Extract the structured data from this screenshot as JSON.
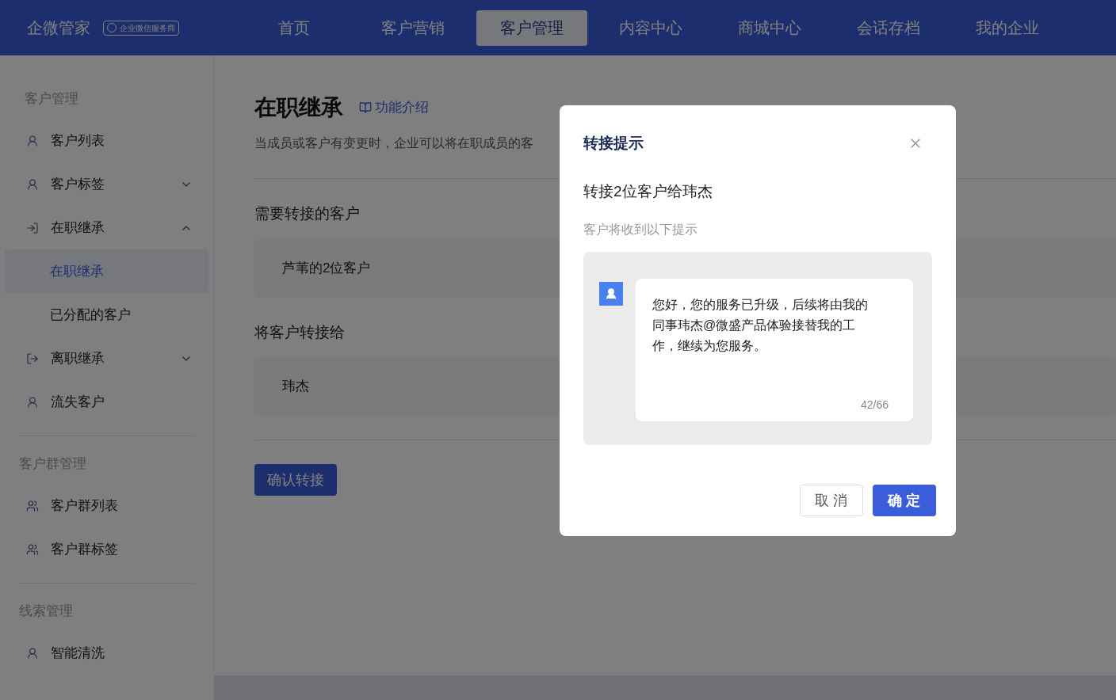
{
  "header": {
    "brand": "企微管家",
    "badge": "企业微信服务商",
    "nav": [
      {
        "label": "首页",
        "selected": false
      },
      {
        "label": "客户营销",
        "selected": false
      },
      {
        "label": "客户管理",
        "selected": true
      },
      {
        "label": "内容中心",
        "selected": false
      },
      {
        "label": "商城中心",
        "selected": false
      },
      {
        "label": "会话存档",
        "selected": false
      },
      {
        "label": "我的企业",
        "selected": false
      }
    ]
  },
  "sidebar": {
    "groups": [
      {
        "title": "客户管理",
        "items": [
          {
            "label": "客户列表",
            "selected": false
          },
          {
            "label": "客户标签",
            "expanded": false,
            "selected": false
          },
          {
            "label": "在职继承",
            "expanded": true,
            "selected": false,
            "children": [
              {
                "label": "在职继承",
                "selected": true
              },
              {
                "label": "已分配的客户",
                "selected": false
              }
            ]
          },
          {
            "label": "离职继承",
            "expanded": false,
            "selected": false
          },
          {
            "label": "流失客户",
            "selected": false
          }
        ]
      },
      {
        "title": "客户群管理",
        "items": [
          {
            "label": "客户群列表",
            "selected": false
          },
          {
            "label": "客户群标签",
            "selected": false
          }
        ]
      },
      {
        "title": "线索管理",
        "items": [
          {
            "label": "智能清洗",
            "selected": false
          }
        ]
      }
    ]
  },
  "main": {
    "title": "在职继承",
    "intro_link": "功能介绍",
    "description": "当成员或客户有变更时，企业可以将在职成员的客",
    "sections": [
      {
        "label": "需要转接的客户",
        "value": "芦苇的2位客户"
      },
      {
        "label": "将客户转接给",
        "value": "玮杰"
      }
    ],
    "confirm_button": "确认转接"
  },
  "dialog": {
    "title": "转接提示",
    "summary": "转接2位客户给玮杰",
    "hint": "客户将收到以下提示",
    "message": "您好，您的服务已升级，后续将由我的同事玮杰@微盛产品体验接替我的工作，继续为您服务。",
    "counter": "42/66",
    "buttons": [
      {
        "label": "取 消",
        "kind": "secondary"
      },
      {
        "label": "确 定",
        "kind": "primary"
      }
    ]
  }
}
